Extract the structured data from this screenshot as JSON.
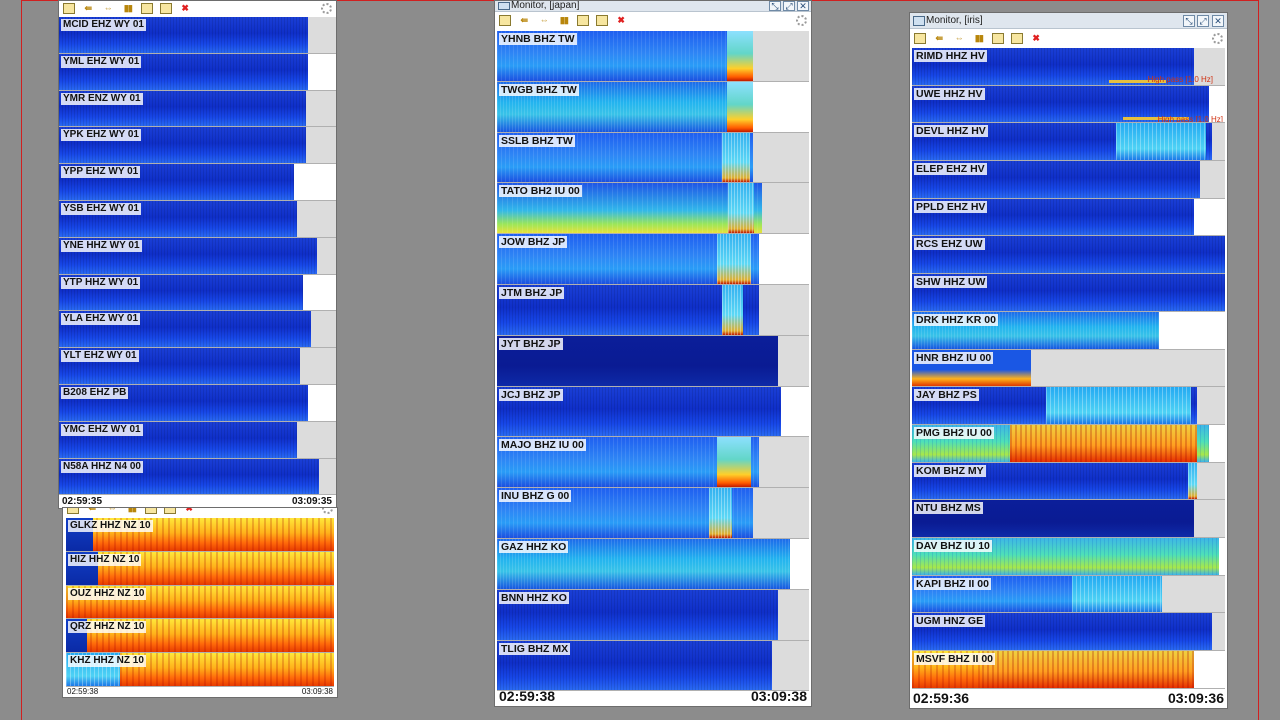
{
  "left_window": {
    "rows": [
      {
        "label": "MCID EHZ WY 01",
        "style": "blue"
      },
      {
        "label": "YML EHZ WY 01",
        "style": "blue"
      },
      {
        "label": "YMR ENZ WY 01",
        "style": "blue"
      },
      {
        "label": "YPK EHZ WY 01",
        "style": "blue"
      },
      {
        "label": "YPP EHZ WY 01",
        "style": "blue"
      },
      {
        "label": "YSB EHZ WY 01",
        "style": "blue"
      },
      {
        "label": "YNE HHZ WY 01",
        "style": "blue"
      },
      {
        "label": "YTP HHZ WY 01",
        "style": "blue"
      },
      {
        "label": "YLA EHZ WY 01",
        "style": "blue"
      },
      {
        "label": "YLT EHZ WY 01",
        "style": "blue"
      },
      {
        "label": "B208 EHZ PB",
        "style": "blue"
      },
      {
        "label": "YMC EHZ WY 01",
        "style": "blue"
      },
      {
        "label": "N58A HHZ N4 00",
        "style": "blue"
      }
    ],
    "time_start": "02:59:35",
    "time_end": "03:09:35"
  },
  "nz_window": {
    "rows": [
      {
        "label": "GLKZ HHZ NZ 10",
        "style": "hot"
      },
      {
        "label": "HIZ HHZ NZ 10",
        "style": "hot"
      },
      {
        "label": "OUZ HHZ NZ 10",
        "style": "hot"
      },
      {
        "label": "QRZ HHZ NZ 10",
        "style": "hot"
      },
      {
        "label": "KHZ HHZ NZ 10",
        "style": "hot"
      }
    ],
    "time_start": "02:59:38",
    "time_end": "03:09:38"
  },
  "japan_window": {
    "title": "Monitor, [japan]",
    "rows": [
      {
        "label": "YHNB BHZ TW",
        "style": "blue-light"
      },
      {
        "label": "TWGB BHZ TW",
        "style": "cyan"
      },
      {
        "label": "SSLB BHZ TW",
        "style": "blue-light"
      },
      {
        "label": "TATO BH2 IU 00",
        "style": "mix"
      },
      {
        "label": "JOW BHZ JP",
        "style": "blue-light"
      },
      {
        "label": "JTM BHZ JP",
        "style": "blue"
      },
      {
        "label": "JYT BHZ JP",
        "style": "navy"
      },
      {
        "label": "JCJ BHZ JP",
        "style": "blue"
      },
      {
        "label": "MAJO BHZ IU 00",
        "style": "blue-light"
      },
      {
        "label": "INU BHZ G 00",
        "style": "blue-light"
      },
      {
        "label": "GAZ HHZ KO",
        "style": "cyan"
      },
      {
        "label": "BNN HHZ KO",
        "style": "blue"
      },
      {
        "label": "TLIG BHZ MX",
        "style": "blue"
      }
    ],
    "time_start": "02:59:38",
    "time_end": "03:09:38"
  },
  "iris_window": {
    "title": "Monitor, [iris]",
    "high_pass": "High pass [1.0 Hz]",
    "rows": [
      {
        "label": "RIMD HHZ HV",
        "style": "blue"
      },
      {
        "label": "UWE HHZ HV",
        "style": "blue"
      },
      {
        "label": "DEVL HHZ HV",
        "style": "blue"
      },
      {
        "label": "ELEP EHZ HV",
        "style": "blue"
      },
      {
        "label": "PPLD EHZ HV",
        "style": "blue"
      },
      {
        "label": "RCS EHZ UW",
        "style": "blue"
      },
      {
        "label": "SHW HHZ UW",
        "style": "blue"
      },
      {
        "label": "DRK HHZ KR 00",
        "style": "cyan"
      },
      {
        "label": "HNR BHZ IU 00",
        "style": "green"
      },
      {
        "label": "JAY BHZ PS",
        "style": "blue"
      },
      {
        "label": "PMG BH2 IU 00",
        "style": "green"
      },
      {
        "label": "KOM BHZ MY",
        "style": "blue"
      },
      {
        "label": "NTU BHZ MS",
        "style": "navy"
      },
      {
        "label": "DAV BHZ IU 10",
        "style": "green"
      },
      {
        "label": "KAPI BHZ II 00",
        "style": "blue-light"
      },
      {
        "label": "UGM HNZ GE",
        "style": "blue"
      },
      {
        "label": "MSVF BHZ II 00",
        "style": "hot"
      }
    ],
    "time_start": "02:59:36",
    "time_end": "03:09:36"
  }
}
